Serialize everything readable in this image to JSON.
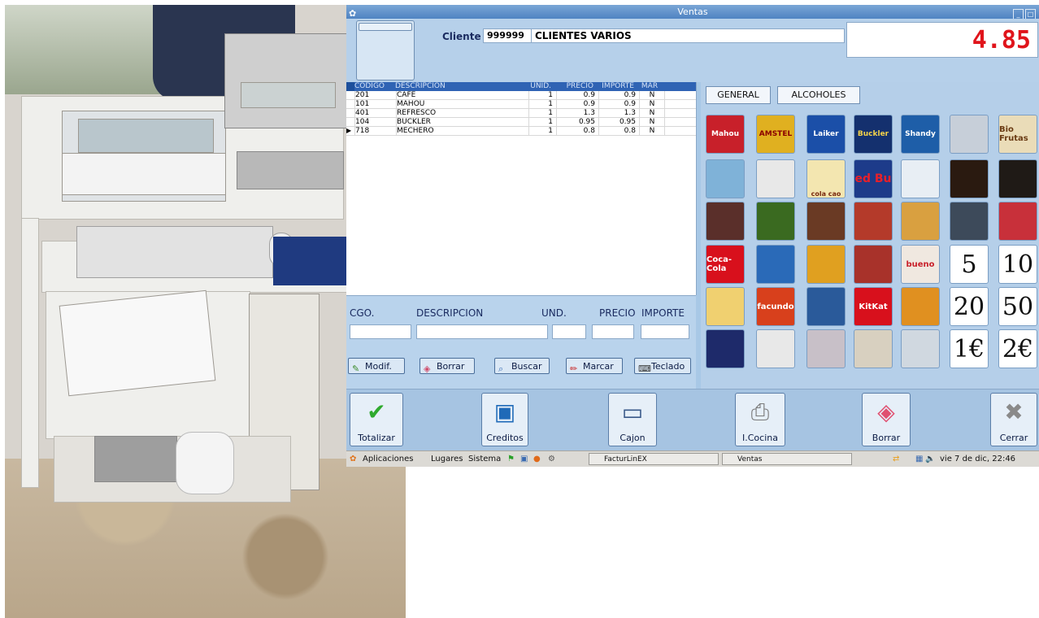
{
  "window": {
    "title": "Ventas"
  },
  "cliente": {
    "label": "Cliente",
    "code": "999999",
    "name": "CLIENTES VARIOS"
  },
  "total": "4.85",
  "table": {
    "columns": [
      "CODIGO",
      "DESCRIPCION",
      "UNID.",
      "PRECIO",
      "IMPORTE",
      "MAR"
    ],
    "rows": [
      {
        "codigo": "201",
        "descripcion": "CAFE",
        "unid": "1",
        "precio": "0.9",
        "importe": "0.9",
        "mar": "N"
      },
      {
        "codigo": "101",
        "descripcion": "MAHOU",
        "unid": "1",
        "precio": "0.9",
        "importe": "0.9",
        "mar": "N"
      },
      {
        "codigo": "401",
        "descripcion": "REFRESCO",
        "unid": "1",
        "precio": "1.3",
        "importe": "1.3",
        "mar": "N"
      },
      {
        "codigo": "104",
        "descripcion": "BUCKLER",
        "unid": "1",
        "precio": "0.95",
        "importe": "0.95",
        "mar": "N"
      },
      {
        "codigo": "718",
        "descripcion": "MECHERO",
        "unid": "1",
        "precio": "0.8",
        "importe": "0.8",
        "mar": "N"
      }
    ]
  },
  "entry": {
    "labels": {
      "cgo": "CGO.",
      "descripcion": "DESCRIPCION",
      "und": "UND.",
      "precio": "PRECIO",
      "importe": "IMPORTE"
    },
    "buttons": {
      "modif": "Modif.",
      "borrar": "Borrar",
      "buscar": "Buscar",
      "marcar": "Marcar",
      "teclado": "Teclado"
    }
  },
  "tabs": {
    "general": "GENERAL",
    "alcoholes": "ALCOHOLES"
  },
  "products": {
    "mahou": "Mahou",
    "amstel": "AMSTEL",
    "laiker": "Laiker",
    "buckler": "Buckler",
    "shandy": "Shandy",
    "biofrutas": "Bio Frutas",
    "colacao": "cola cao",
    "redbull": "ed Bu",
    "cocacola": "Coca-Cola",
    "bueno": "bueno",
    "facundo": "facundo",
    "kitkat": "KitKat",
    "n5": "5",
    "n10": "10",
    "n20": "20",
    "n50": "50",
    "n1": "1€",
    "n2": "2€"
  },
  "bottom": {
    "totalizar": "Totalizar",
    "creditos": "Creditos",
    "cajon": "Cajon",
    "icocina": "I.Cocina",
    "borrar": "Borrar",
    "cerrar": "Cerrar"
  },
  "taskbar": {
    "aplicaciones": "Aplicaciones",
    "lugares": "Lugares",
    "sistema": "Sistema",
    "win1": "FacturLinEX",
    "win2": "Ventas",
    "clock": "vie  7 de dic, 22:46"
  },
  "colors": {
    "accent": "#2f63b4",
    "total": "#e0141b",
    "panel": "#b5cfe9"
  }
}
